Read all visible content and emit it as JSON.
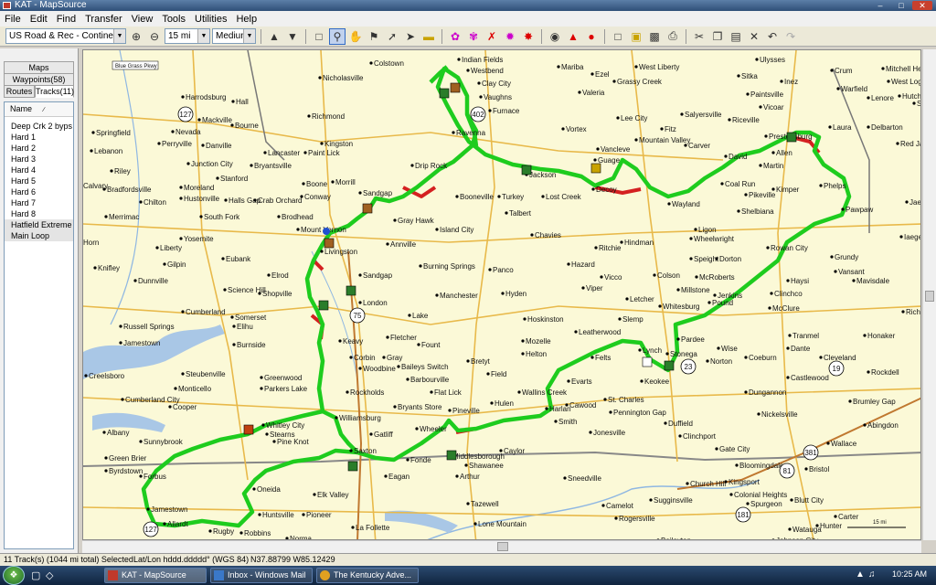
{
  "window": {
    "title": "KAT - MapSource"
  },
  "menu": [
    "File",
    "Edit",
    "Find",
    "Transfer",
    "View",
    "Tools",
    "Utilities",
    "Help"
  ],
  "toolbar": {
    "map_product": "US Road & Rec - Continental US",
    "zoom": "15 mi",
    "detail": "Medium"
  },
  "panel": {
    "tabs_row1": [
      "Maps"
    ],
    "tabs_row2": [
      "Waypoints(58)"
    ],
    "tabs_row3": [
      "Routes",
      "Tracks(11)"
    ],
    "list_header": "Name",
    "tracks": [
      "Deep Crk 2 byps",
      "Hard 1",
      "Hard 2",
      "Hard 3",
      "Hard 4",
      "Hard 5",
      "Hard 6",
      "Hard 7",
      "Hard 8",
      "Hatfield Extreme",
      "Main Loop"
    ]
  },
  "map": {
    "cities": [
      [
        "Colstown",
        318,
        8
      ],
      [
        "Indian Fields",
        414,
        4
      ],
      [
        "Mariba",
        523,
        12
      ],
      [
        "West Liberty",
        608,
        12
      ],
      [
        "Ulysses",
        740,
        4
      ],
      [
        "Crum",
        822,
        16
      ],
      [
        "Mitchell Heights",
        878,
        14
      ],
      [
        "Westbend",
        424,
        16
      ],
      [
        "Ezel",
        560,
        20
      ],
      [
        "Sitka",
        720,
        22
      ],
      [
        "Inez",
        767,
        28
      ],
      [
        "West Logan",
        884,
        28
      ],
      [
        "Nicholasville",
        262,
        24
      ],
      [
        "Clay City",
        436,
        30
      ],
      [
        "Grassy Creek",
        584,
        28
      ],
      [
        "Warfield",
        829,
        36
      ],
      [
        "Hutchinson",
        896,
        44
      ],
      [
        "Harrodsburg",
        112,
        45
      ],
      [
        "Hall",
        167,
        50
      ],
      [
        "Vaughns",
        438,
        45
      ],
      [
        "Valeria",
        546,
        40
      ],
      [
        "Paintsville",
        730,
        42
      ],
      [
        "Lenore",
        862,
        46
      ],
      [
        "Stollings",
        912,
        52
      ],
      [
        "Mackville",
        130,
        70
      ],
      [
        "Richmond",
        250,
        66
      ],
      [
        "Furnace",
        448,
        60
      ],
      [
        "Salyersville",
        658,
        64
      ],
      [
        "Riceville",
        710,
        70
      ],
      [
        "Vicoar",
        744,
        56
      ],
      [
        "Chapmanville",
        933,
        64
      ],
      [
        "Stirrat",
        934,
        74
      ],
      [
        "Bourne",
        166,
        76
      ],
      [
        "Ravenna",
        408,
        84
      ],
      [
        "Vortex",
        528,
        80
      ],
      [
        "Lee City",
        588,
        68
      ],
      [
        "Fitz",
        636,
        80
      ],
      [
        "Laura",
        820,
        78
      ],
      [
        "Delbarton",
        862,
        78
      ],
      [
        "Springfield",
        14,
        84
      ],
      [
        "Nevada",
        101,
        83
      ],
      [
        "Kingston",
        264,
        96
      ],
      [
        "Mountain Valley",
        608,
        92
      ],
      [
        "Carver",
        662,
        98
      ],
      [
        "Prestonsburg",
        750,
        88
      ],
      [
        "Red Jacket",
        894,
        96
      ],
      [
        "Perryville",
        86,
        96
      ],
      [
        "Danville",
        134,
        98
      ],
      [
        "Lancaster",
        202,
        106
      ],
      [
        "Paint Lick",
        246,
        106
      ],
      [
        "Vancleve",
        566,
        102
      ],
      [
        "Allen",
        758,
        106
      ],
      [
        "Gilbet",
        938,
        108
      ],
      [
        "Lebanon",
        12,
        104
      ],
      [
        "Junction City",
        118,
        118
      ],
      [
        "Bryantsville",
        187,
        120
      ],
      [
        "Drip Rock",
        363,
        120
      ],
      [
        "Guage",
        563,
        114
      ],
      [
        "David",
        706,
        110
      ],
      [
        "Martin",
        744,
        120
      ],
      [
        "Gilbert Creek",
        932,
        120
      ],
      [
        "Riley",
        34,
        126
      ],
      [
        "Boone",
        244,
        140
      ],
      [
        "Morrill",
        276,
        138
      ],
      [
        "Jackson",
        488,
        130
      ],
      [
        "Stanford",
        150,
        134
      ],
      [
        "Calvary",
        0,
        142
      ],
      [
        "Bradfordsville",
        26,
        146
      ],
      [
        "Moreland",
        110,
        144
      ],
      [
        "Chilton",
        66,
        160
      ],
      [
        "Hustonville",
        110,
        156
      ],
      [
        "Halls Gap",
        159,
        158
      ],
      [
        "Crab Orchard",
        191,
        158
      ],
      [
        "Conway",
        242,
        154
      ],
      [
        "Sandgap",
        306,
        150
      ],
      [
        "Booneville",
        412,
        154
      ],
      [
        "Turkey",
        458,
        154
      ],
      [
        "Lost Creek",
        506,
        154
      ],
      [
        "Decoy",
        561,
        146
      ],
      [
        "Wayland",
        644,
        162
      ],
      [
        "Coal Run",
        702,
        140
      ],
      [
        "Pikeville",
        728,
        152
      ],
      [
        "Kimper",
        758,
        146
      ],
      [
        "Phelps",
        810,
        142
      ],
      [
        "Jaeger",
        904,
        160
      ],
      [
        "Merrimac",
        28,
        176
      ],
      [
        "South Fork",
        132,
        176
      ],
      [
        "Brodhead",
        217,
        176
      ],
      [
        "Mount Vernon",
        238,
        190
      ],
      [
        "Gray Hawk",
        344,
        180
      ],
      [
        "Island City",
        390,
        190
      ],
      [
        "Talbert",
        466,
        172
      ],
      [
        "Shelbiana",
        720,
        170
      ],
      [
        "Pawpaw",
        834,
        168
      ],
      [
        "Horn",
        0,
        204
      ],
      [
        "Liberty",
        84,
        210
      ],
      [
        "Yosemite",
        110,
        200
      ],
      [
        "Annville",
        336,
        206
      ],
      [
        "Chavies",
        494,
        196
      ],
      [
        "Ritchie",
        564,
        210
      ],
      [
        "Hindman",
        592,
        204
      ],
      [
        "Ligon",
        673,
        190
      ],
      [
        "Wheelwright",
        668,
        200
      ],
      [
        "Rowan City",
        752,
        210
      ],
      [
        "Knifley",
        16,
        232
      ],
      [
        "Eubank",
        156,
        222
      ],
      [
        "Livingston",
        264,
        214
      ],
      [
        "Speight",
        668,
        222
      ],
      [
        "Dorton",
        696,
        222
      ],
      [
        "Grundy",
        822,
        220
      ],
      [
        "Iaeger",
        898,
        198
      ],
      [
        "Gilpin",
        92,
        228
      ],
      [
        "Burning Springs",
        372,
        230
      ],
      [
        "Panco",
        448,
        234
      ],
      [
        "Hazard",
        534,
        228
      ],
      [
        "Vicco",
        570,
        242
      ],
      [
        "Colson",
        628,
        240
      ],
      [
        "McRoberts",
        674,
        242
      ],
      [
        "Vansant",
        826,
        236
      ],
      [
        "Mavisdale",
        846,
        246
      ],
      [
        "Dunnville",
        60,
        246
      ],
      [
        "Elrod",
        206,
        240
      ],
      [
        "Sandgap",
        306,
        240
      ],
      [
        "Hyden",
        462,
        260
      ],
      [
        "Viper",
        550,
        254
      ],
      [
        "Millstone",
        654,
        256
      ],
      [
        "Jenkins",
        694,
        262
      ],
      [
        "Haysi",
        774,
        246
      ],
      [
        "Science Hill",
        158,
        256
      ],
      [
        "Shopville",
        196,
        260
      ],
      [
        "London",
        306,
        270
      ],
      [
        "Manchester",
        390,
        262
      ],
      [
        "Letcher",
        598,
        266
      ],
      [
        "Whitesburg",
        634,
        274
      ],
      [
        "Pound",
        688,
        270
      ],
      [
        "Clinchco",
        756,
        260
      ],
      [
        "Cumberland",
        112,
        280
      ],
      [
        "Somerset",
        166,
        286
      ],
      [
        "Lake",
        360,
        284
      ],
      [
        "Hoskinston",
        486,
        288
      ],
      [
        "Slemp",
        590,
        288
      ],
      [
        "McClure",
        754,
        276
      ],
      [
        "Richlands",
        900,
        280
      ],
      [
        "Russell Springs",
        44,
        296
      ],
      [
        "Elihu",
        168,
        296
      ],
      [
        "Leatherwood",
        542,
        302
      ],
      [
        "Pardee",
        654,
        310
      ],
      [
        "Tranmel",
        776,
        306
      ],
      [
        "Honaker",
        858,
        306
      ],
      [
        "Jamestown",
        44,
        314
      ],
      [
        "Burnside",
        168,
        316
      ],
      [
        "Keavy",
        284,
        312
      ],
      [
        "Fletcher",
        336,
        308
      ],
      [
        "Fount",
        370,
        316
      ],
      [
        "Mozelle",
        484,
        312
      ],
      [
        "Wise",
        698,
        320
      ],
      [
        "Dante",
        774,
        320
      ],
      [
        "Corbin",
        296,
        330
      ],
      [
        "Gray",
        332,
        330
      ],
      [
        "Helton",
        484,
        326
      ],
      [
        "Felts",
        560,
        330
      ],
      [
        "Lynch",
        612,
        322
      ],
      [
        "Stonega",
        642,
        326
      ],
      [
        "Norton",
        686,
        334
      ],
      [
        "Coeburn",
        728,
        330
      ],
      [
        "Cleveland",
        810,
        330
      ],
      [
        "Steubenville",
        112,
        348
      ],
      [
        "Woodbine",
        306,
        342
      ],
      [
        "Baileys Switch",
        348,
        340
      ],
      [
        "Bretyt",
        424,
        334
      ],
      [
        "Creelsboro",
        6,
        350
      ],
      [
        "Greenwood",
        198,
        352
      ],
      [
        "Rockholds",
        292,
        368
      ],
      [
        "Barbourville",
        358,
        354
      ],
      [
        "Field",
        446,
        348
      ],
      [
        "Evarts",
        534,
        356
      ],
      [
        "Keokee",
        614,
        356
      ],
      [
        "Castlewood",
        774,
        352
      ],
      [
        "Rockdell",
        862,
        346
      ],
      [
        "Cumberland City",
        46,
        376
      ],
      [
        "Monticello",
        104,
        364
      ],
      [
        "Parkers Lake",
        198,
        364
      ],
      [
        "Flat Lick",
        384,
        368
      ],
      [
        "Wallins Creek",
        480,
        368
      ],
      [
        "Cawood",
        532,
        382
      ],
      [
        "St. Charles",
        574,
        376
      ],
      [
        "Dungannon",
        728,
        368
      ],
      [
        "Cooper",
        98,
        384
      ],
      [
        "Bryants Store",
        344,
        384
      ],
      [
        "Pineville",
        404,
        388
      ],
      [
        "Hulen",
        450,
        380
      ],
      [
        "Harlan",
        510,
        386
      ],
      [
        "Smith",
        520,
        400
      ],
      [
        "Pennington Gap",
        580,
        390
      ],
      [
        "Brumley Gap",
        842,
        378
      ],
      [
        "Albany",
        26,
        412
      ],
      [
        "Williamsburg",
        280,
        396
      ],
      [
        "Jonesville",
        558,
        412
      ],
      [
        "Duffield",
        640,
        402
      ],
      [
        "Nickelsville",
        742,
        392
      ],
      [
        "Abingdon",
        858,
        404
      ],
      [
        "Whitley City",
        200,
        404
      ],
      [
        "Stearns",
        204,
        414
      ],
      [
        "Wheeler",
        368,
        408
      ],
      [
        "Clinchport",
        656,
        416
      ],
      [
        "Sunnybrook",
        66,
        422
      ],
      [
        "Pine Knot",
        212,
        422
      ],
      [
        "Gatliff",
        318,
        414
      ],
      [
        "Middlesborough",
        404,
        438
      ],
      [
        "Caylor",
        460,
        432
      ],
      [
        "Gate City",
        696,
        430
      ],
      [
        "Wallace",
        818,
        424
      ],
      [
        "Green Brier",
        28,
        440
      ],
      [
        "Saxton",
        296,
        432
      ],
      [
        "Fonde",
        358,
        442
      ],
      [
        "Shawanee",
        422,
        448
      ],
      [
        "Bloomingdale",
        718,
        448
      ],
      [
        "Bristol",
        794,
        452
      ],
      [
        "Byrdstown",
        28,
        454
      ],
      [
        "Forbus",
        66,
        460
      ],
      [
        "Eagan",
        334,
        460
      ],
      [
        "Arthur",
        412,
        460
      ],
      [
        "Sneedville",
        530,
        462
      ],
      [
        "Church Hill",
        664,
        468
      ],
      [
        "Kingsport",
        706,
        466
      ],
      [
        "Elk Valley",
        256,
        480
      ],
      [
        "Colonial Heights",
        712,
        480
      ],
      [
        "Blutt City",
        778,
        486
      ],
      [
        "Oneida",
        190,
        474
      ],
      [
        "Tazewell",
        424,
        490
      ],
      [
        "Sugginsville",
        624,
        486
      ],
      [
        "Jamestown",
        74,
        496
      ],
      [
        "Camelot",
        572,
        492
      ],
      [
        "Spurgeon",
        730,
        490
      ],
      [
        "Huntsville",
        196,
        502
      ],
      [
        "Pioneer",
        244,
        502
      ],
      [
        "Carter",
        826,
        504
      ],
      [
        "Allardt",
        92,
        512
      ],
      [
        "Lone Mountain",
        432,
        512
      ],
      [
        "Rogersville",
        586,
        506
      ],
      [
        "Watauga",
        776,
        518
      ],
      [
        "Hunter",
        806,
        514
      ],
      [
        "Rugby",
        142,
        520
      ],
      [
        "Robbins",
        176,
        522
      ],
      [
        "La Follette",
        298,
        516
      ],
      [
        "Johnson City",
        758,
        530
      ],
      [
        "Norma",
        226,
        528
      ],
      [
        "Caryville",
        268,
        532
      ],
      [
        "Baileyton",
        632,
        530
      ]
    ],
    "roads": [
      [
        "127",
        112,
        70
      ],
      [
        "75",
        300,
        290
      ],
      [
        "23",
        662,
        346
      ],
      [
        "19",
        824,
        348
      ],
      [
        "402",
        432,
        70
      ],
      [
        "81",
        770,
        460
      ],
      [
        "381",
        796,
        440
      ],
      [
        "181",
        722,
        508
      ],
      [
        "127",
        74,
        524
      ]
    ],
    "blue_grass_label": "Blue Grass Pkwy",
    "scale_label": "15 mi"
  },
  "status": {
    "selection": "11 Track(s) (1044 mi total) Selected",
    "latlon_label": "Lat/Lon hddd.ddddd° (WGS 84)",
    "coords": "N37.88799 W85.12429"
  },
  "taskbar": {
    "apps": [
      "KAT - MapSource",
      "Inbox - Windows Mail",
      "The Kentucky Adve..."
    ],
    "clock": "10:25 AM"
  },
  "colors": {
    "track_main": "#1ecc1e",
    "track_alt": "#d42020",
    "map_bg": "#fbf9d7",
    "water": "#a9c7e6"
  }
}
